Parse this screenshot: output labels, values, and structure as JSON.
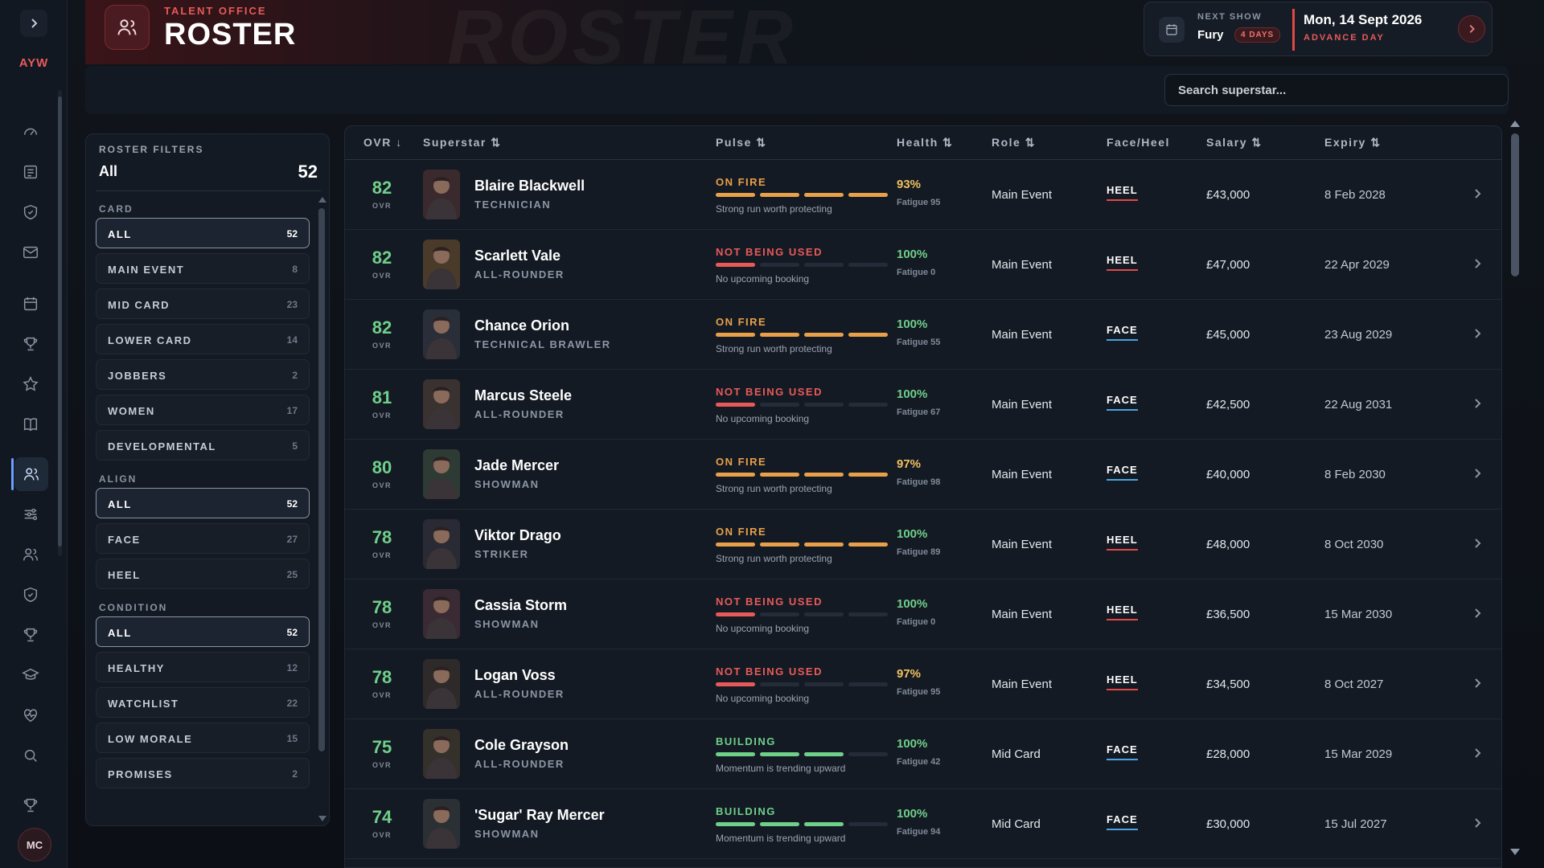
{
  "brand": "AYW",
  "user_initials": "MC",
  "header": {
    "eyebrow": "TALENT OFFICE",
    "title": "ROSTER",
    "ghost_text": "ROSTER"
  },
  "next_show": {
    "label": "NEXT SHOW",
    "name": "Fury",
    "days_badge": "4 DAYS",
    "date": "Mon, 14 Sept 2026",
    "advance_label": "ADVANCE DAY"
  },
  "search": {
    "placeholder": "Search superstar..."
  },
  "filters": {
    "title": "ROSTER FILTERS",
    "current": "All",
    "total": "52",
    "groups": [
      {
        "label": "CARD",
        "items": [
          {
            "label": "ALL",
            "count": "52",
            "selected": true
          },
          {
            "label": "MAIN EVENT",
            "count": "8"
          },
          {
            "label": "MID CARD",
            "count": "23"
          },
          {
            "label": "LOWER CARD",
            "count": "14"
          },
          {
            "label": "JOBBERS",
            "count": "2"
          },
          {
            "label": "WOMEN",
            "count": "17"
          },
          {
            "label": "DEVELOPMENTAL",
            "count": "5"
          }
        ]
      },
      {
        "label": "ALIGN",
        "items": [
          {
            "label": "ALL",
            "count": "52",
            "selected": true
          },
          {
            "label": "FACE",
            "count": "27"
          },
          {
            "label": "HEEL",
            "count": "25"
          }
        ]
      },
      {
        "label": "CONDITION",
        "items": [
          {
            "label": "ALL",
            "count": "52",
            "selected": true
          },
          {
            "label": "HEALTHY",
            "count": "12"
          },
          {
            "label": "WATCHLIST",
            "count": "22"
          },
          {
            "label": "LOW MORALE",
            "count": "15"
          },
          {
            "label": "PROMISES",
            "count": "2"
          }
        ]
      }
    ]
  },
  "table": {
    "columns": {
      "ovr": "OVR ↓",
      "superstar": "Superstar ⇅",
      "pulse": "Pulse ⇅",
      "health": "Health ⇅",
      "role": "Role ⇅",
      "align": "Face/Heel",
      "salary": "Salary ⇅",
      "expiry": "Expiry ⇅"
    },
    "ovr_label": "OVR",
    "rows": [
      {
        "ovr": "82",
        "name": "Blaire Blackwell",
        "style": "TECHNICIAN",
        "pulse": "ON FIRE",
        "pulse_level": 4,
        "pulse_note": "Strong run worth protecting",
        "health": "93%",
        "fatigue": "Fatigue 95",
        "role": "Main Event",
        "align": "HEEL",
        "salary": "£43,000",
        "expiry": "8 Feb 2028"
      },
      {
        "ovr": "82",
        "name": "Scarlett Vale",
        "style": "ALL-ROUNDER",
        "pulse": "NOT BEING USED",
        "pulse_level": 1,
        "pulse_note": "No upcoming booking",
        "health": "100%",
        "fatigue": "Fatigue 0",
        "role": "Main Event",
        "align": "HEEL",
        "salary": "£47,000",
        "expiry": "22 Apr 2029"
      },
      {
        "ovr": "82",
        "name": "Chance Orion",
        "style": "TECHNICAL BRAWLER",
        "pulse": "ON FIRE",
        "pulse_level": 4,
        "pulse_note": "Strong run worth protecting",
        "health": "100%",
        "fatigue": "Fatigue 55",
        "role": "Main Event",
        "align": "FACE",
        "salary": "£45,000",
        "expiry": "23 Aug 2029"
      },
      {
        "ovr": "81",
        "name": "Marcus Steele",
        "style": "ALL-ROUNDER",
        "pulse": "NOT BEING USED",
        "pulse_level": 1,
        "pulse_note": "No upcoming booking",
        "health": "100%",
        "fatigue": "Fatigue 67",
        "role": "Main Event",
        "align": "FACE",
        "salary": "£42,500",
        "expiry": "22 Aug 2031"
      },
      {
        "ovr": "80",
        "name": "Jade Mercer",
        "style": "SHOWMAN",
        "pulse": "ON FIRE",
        "pulse_level": 4,
        "pulse_note": "Strong run worth protecting",
        "health": "97%",
        "fatigue": "Fatigue 98",
        "role": "Main Event",
        "align": "FACE",
        "salary": "£40,000",
        "expiry": "8 Feb 2030"
      },
      {
        "ovr": "78",
        "name": "Viktor Drago",
        "style": "STRIKER",
        "pulse": "ON FIRE",
        "pulse_level": 4,
        "pulse_note": "Strong run worth protecting",
        "health": "100%",
        "fatigue": "Fatigue 89",
        "role": "Main Event",
        "align": "HEEL",
        "salary": "£48,000",
        "expiry": "8 Oct 2030"
      },
      {
        "ovr": "78",
        "name": "Cassia Storm",
        "style": "SHOWMAN",
        "pulse": "NOT BEING USED",
        "pulse_level": 1,
        "pulse_note": "No upcoming booking",
        "health": "100%",
        "fatigue": "Fatigue 0",
        "role": "Main Event",
        "align": "HEEL",
        "salary": "£36,500",
        "expiry": "15 Mar 2030"
      },
      {
        "ovr": "78",
        "name": "Logan Voss",
        "style": "ALL-ROUNDER",
        "pulse": "NOT BEING USED",
        "pulse_level": 1,
        "pulse_note": "No upcoming booking",
        "health": "97%",
        "fatigue": "Fatigue 95",
        "role": "Main Event",
        "align": "HEEL",
        "salary": "£34,500",
        "expiry": "8 Oct 2027"
      },
      {
        "ovr": "75",
        "name": "Cole Grayson",
        "style": "ALL-ROUNDER",
        "pulse": "BUILDING",
        "pulse_level": 3,
        "pulse_note": "Momentum is trending upward",
        "health": "100%",
        "fatigue": "Fatigue 42",
        "role": "Mid Card",
        "align": "FACE",
        "salary": "£28,000",
        "expiry": "15 Mar 2029"
      },
      {
        "ovr": "74",
        "name": "'Sugar' Ray Mercer",
        "style": "SHOWMAN",
        "pulse": "BUILDING",
        "pulse_level": 3,
        "pulse_note": "Momentum is trending upward",
        "health": "100%",
        "fatigue": "Fatigue 94",
        "role": "Mid Card",
        "align": "FACE",
        "salary": "£30,000",
        "expiry": "15 Jul 2027"
      }
    ]
  },
  "colors": {
    "on_fire": "#e8a04a",
    "not_used": "#e85a5a",
    "building": "#6fd08a",
    "heel": "#e24848",
    "face": "#4aa3e0",
    "health_full": "#6fd08a",
    "health_high": "#f0c060"
  }
}
